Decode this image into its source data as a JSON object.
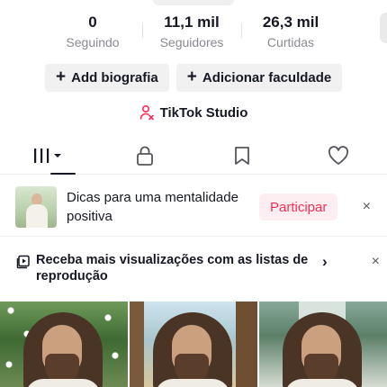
{
  "stats": [
    {
      "value": "0",
      "label": "Seguindo"
    },
    {
      "value": "11,1 mil",
      "label": "Seguidores"
    },
    {
      "value": "26,3 mil",
      "label": "Curtidas"
    }
  ],
  "actions": {
    "add_bio": "Add biografia",
    "add_school": "Adicionar faculdade",
    "plus": "+"
  },
  "studio": {
    "label": "TikTok Studio",
    "accent": "#fe2c55"
  },
  "tabs": [
    {
      "icon": "videos-grid-icon",
      "active": true
    },
    {
      "icon": "lock-icon"
    },
    {
      "icon": "bookmark-icon"
    },
    {
      "icon": "heart-icon"
    }
  ],
  "promo": {
    "title": "Dicas para uma mentalidade positiva",
    "join_label": "Participar",
    "close": "×"
  },
  "playlist": {
    "text": "Receba mais visualizações com as listas de reprodução",
    "chevron": "›",
    "close": "×"
  },
  "colors": {
    "text": "#161823",
    "secondary": "#8a8b91",
    "accent": "#fe2c55",
    "pill_bg": "#f1f1f2"
  }
}
